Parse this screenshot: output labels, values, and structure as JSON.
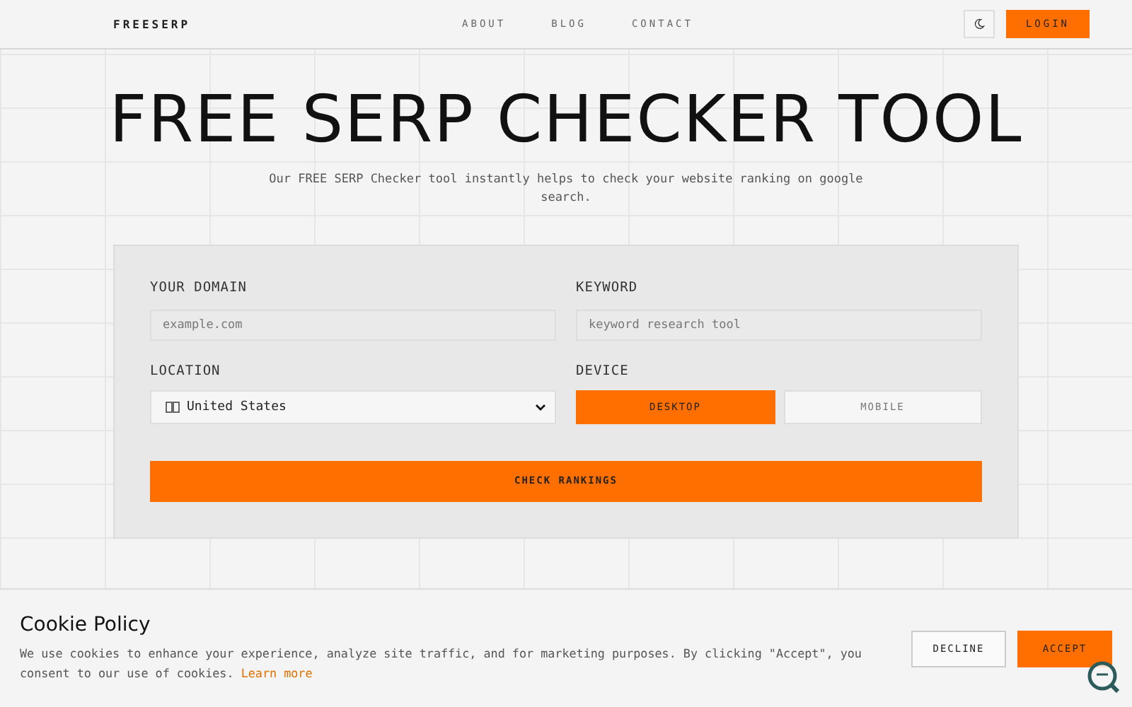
{
  "header": {
    "logo": "FREESERP",
    "nav": [
      {
        "label": "ABOUT"
      },
      {
        "label": "BLOG"
      },
      {
        "label": "CONTACT"
      }
    ],
    "login": "LOGIN"
  },
  "hero": {
    "title": "FREE SERP CHECKER TOOL",
    "subtitle": "Our FREE SERP Checker tool instantly helps to check your website ranking on google search."
  },
  "form": {
    "domain": {
      "label": "YOUR DOMAIN",
      "placeholder": "example.com"
    },
    "keyword": {
      "label": "KEYWORD",
      "placeholder": "keyword research tool"
    },
    "location": {
      "label": "LOCATION",
      "value": "United States"
    },
    "device": {
      "label": "DEVICE",
      "options": [
        {
          "label": "DESKTOP",
          "selected": true
        },
        {
          "label": "MOBILE",
          "selected": false
        }
      ]
    },
    "submit": "CHECK RANKINGS"
  },
  "cookie_banner": {
    "title": "Cookie Policy",
    "text": "We use cookies to enhance your experience, analyze site traffic, and for marketing purposes. By clicking \"Accept\", you consent to our use of cookies.",
    "link": "Learn more",
    "buttons": [
      "DECLINE",
      "ACCEPT"
    ]
  }
}
